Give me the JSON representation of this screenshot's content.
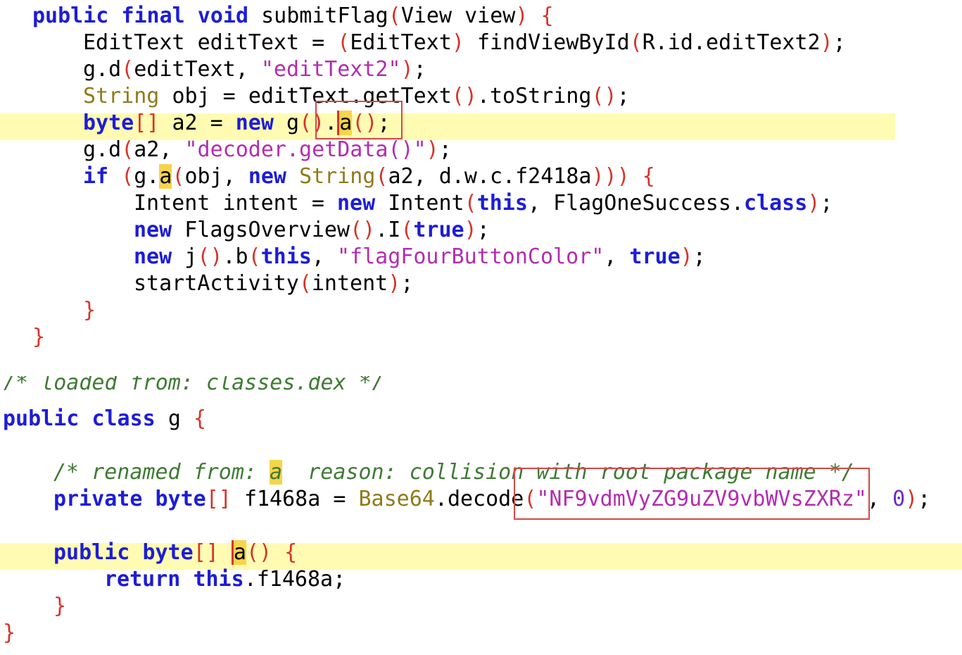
{
  "method": {
    "sig": {
      "public": "public",
      "final": "final",
      "void": "void",
      "name": "submitFlag",
      "param_type": "View",
      "param_name": "view"
    },
    "line1": {
      "type": "EditText",
      "var": "editText",
      "cast": "EditText",
      "call": "findViewById",
      "arg": "R.id.editText2"
    },
    "line2": {
      "call": "g.d",
      "arg": "editText",
      "str": "\"editText2\""
    },
    "line3": {
      "type": "String",
      "var": "obj",
      "call": "editText.getText",
      "tail": "toString"
    },
    "line4": {
      "kw": "byte",
      "var": "a2",
      "new": "new",
      "cls": "g",
      "method": "a"
    },
    "line5": {
      "call": "g.d",
      "arg": "a2",
      "str": "\"decoder.getData()\""
    },
    "line6": {
      "if": "if",
      "call": "g.",
      "method": "a",
      "arg": "obj",
      "new": "new",
      "type": "String",
      "args": "a2, d.w.c.f2418a"
    },
    "line7": {
      "type": "Intent",
      "var": "intent",
      "new": "new",
      "cls": "Intent",
      "this": "this",
      "target": "FlagOneSuccess",
      "class": "class"
    },
    "line8": {
      "new": "new",
      "cls": "FlagsOverview",
      "call": "I",
      "arg": "true"
    },
    "line9": {
      "new": "new",
      "cls": "j",
      "call": "b",
      "this": "this",
      "str": "\"flagFourButtonColor\"",
      "arg": "true"
    },
    "line10": {
      "call": "startActivity",
      "arg": "intent"
    }
  },
  "classg": {
    "partial_comment": "/* loaded from: classes.dex */",
    "decl": {
      "public": "public",
      "class": "class",
      "name": "g"
    },
    "comment": {
      "prefix": "/* renamed from: ",
      "name": "a",
      "suffix": "  reason: collision with root package name */"
    },
    "field": {
      "private": "private",
      "type": "byte",
      "name": "f1468a",
      "cls": "Base64",
      "call": "decode",
      "str": "\"NF9vdmVyZG9uZV9vbWVsZXRz\"",
      "num": "0"
    },
    "method": {
      "public": "public",
      "type": "byte",
      "name": "a"
    },
    "ret": {
      "return": "return",
      "this": "this",
      "field": "f1468a"
    }
  }
}
